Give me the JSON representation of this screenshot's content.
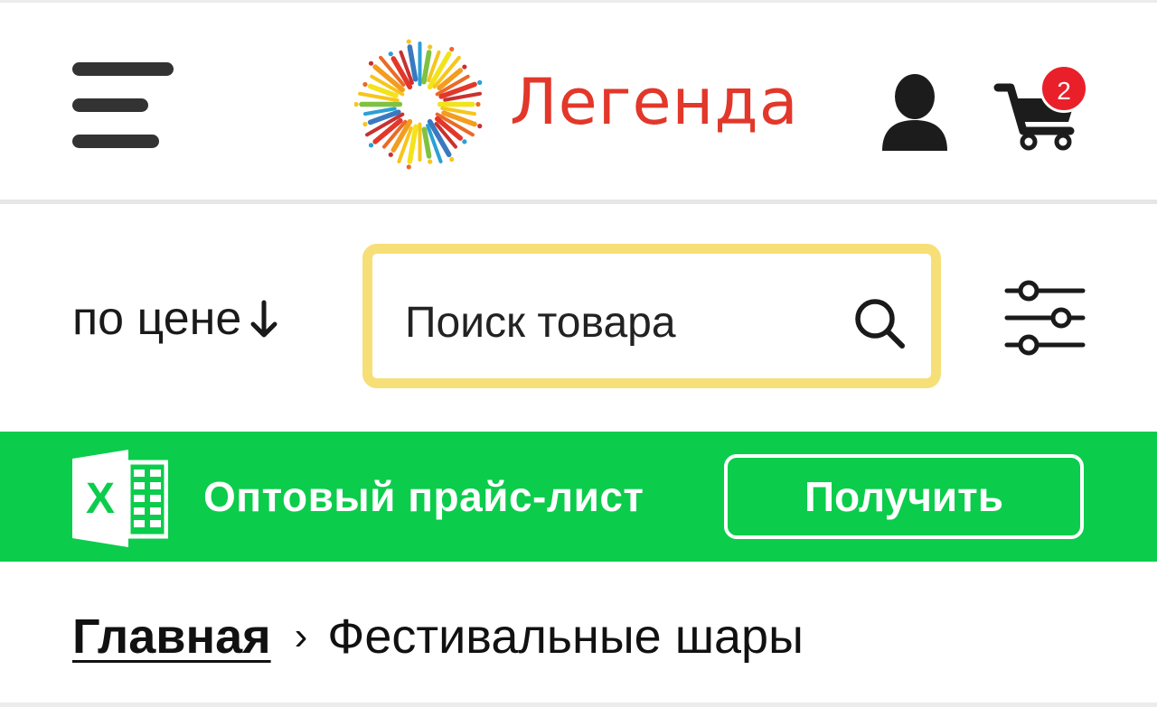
{
  "header": {
    "logo_text": "Легенда",
    "cart_count": "2"
  },
  "toolbar": {
    "sort_label": "по цене",
    "search_placeholder": "Поиск товара"
  },
  "banner": {
    "text": "Оптовый прайс-лист",
    "button_label": "Получить",
    "background_color": "#0ccc4c"
  },
  "breadcrumb": {
    "home": "Главная",
    "separator": "›",
    "current": "Фестивальные шары"
  },
  "colors": {
    "brand_red": "#e2372a",
    "search_border": "#f7df77",
    "badge_red": "#e9202a"
  },
  "icons": {
    "menu": "hamburger-icon",
    "user": "user-icon",
    "cart": "cart-icon",
    "search": "search-icon",
    "filter": "filter-sliders-icon",
    "sort": "arrow-down-icon",
    "excel": "excel-icon"
  }
}
